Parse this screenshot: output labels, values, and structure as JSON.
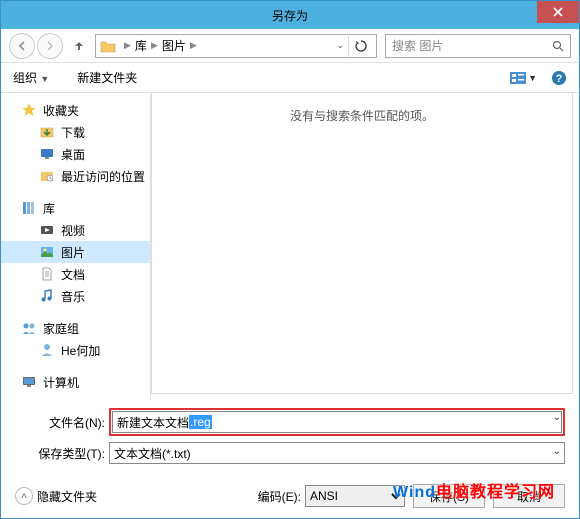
{
  "title": "另存为",
  "nav": {
    "path1": "库",
    "path2": "图片"
  },
  "search": {
    "placeholder": "搜索 图片"
  },
  "toolbar": {
    "organize": "组织",
    "newfolder": "新建文件夹"
  },
  "sidebar": {
    "favorites": "收藏夹",
    "downloads": "下载",
    "desktop": "桌面",
    "recent": "最近访问的位置",
    "libraries": "库",
    "videos": "视频",
    "pictures": "图片",
    "documents": "文档",
    "music": "音乐",
    "homegroup": "家庭组",
    "heuser": "He何加",
    "computer": "计算机"
  },
  "content": {
    "empty": "没有与搜索条件匹配的项。"
  },
  "form": {
    "filename_label": "文件名(N):",
    "filename_value_plain": "新建文本文档",
    "filename_value_sel": ".reg",
    "filetype_label": "保存类型(T):",
    "filetype_value": "文本文档(*.txt)"
  },
  "footer": {
    "hide_folders": "隐藏文件夹",
    "encoding_label": "编码(E):",
    "encoding_value": "ANSI",
    "save": "保存(S)",
    "cancel": "取消"
  },
  "watermark": {
    "blue": "Wind",
    "red": "电脑教程学习网"
  }
}
